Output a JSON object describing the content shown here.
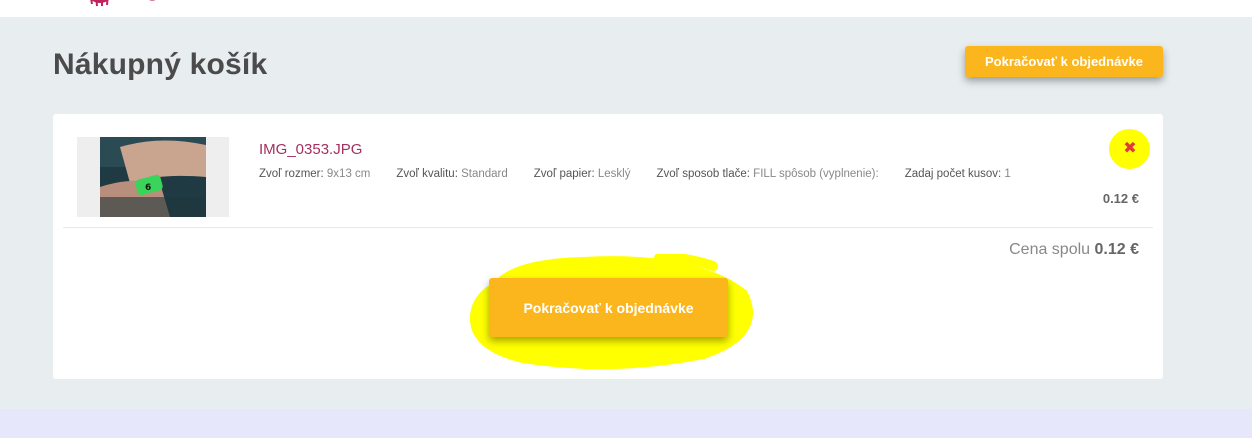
{
  "header": {
    "logo_icon": "brand-logo-icon"
  },
  "page": {
    "title": "Nákupný košík",
    "continue_top_label": "Pokračovať k objednávke"
  },
  "cart": {
    "items": [
      {
        "filename": "IMG_0353.JPG",
        "attributes": [
          {
            "key": "Zvoľ rozmer:",
            "value": "9x13 cm"
          },
          {
            "key": "Zvoľ kvalitu:",
            "value": "Standard"
          },
          {
            "key": "Zvoľ papier:",
            "value": "Lesklý"
          },
          {
            "key": "Zvoľ sposob tlače:",
            "value": "FILL spôsob (vyplnenie):"
          },
          {
            "key": "Zadaj počet kusov:",
            "value": "1"
          }
        ],
        "price": "0.12 €",
        "remove_icon": "close-icon"
      }
    ],
    "total_label": "Cena spolu",
    "total_value": "0.12 €",
    "continue_bottom_label": "Pokračovať k objednávke"
  },
  "colors": {
    "accent": "#fbb61d",
    "filename": "#a3305e",
    "highlight": "#ffff00",
    "remove": "#e03a3a",
    "background": "#e8eef0"
  }
}
